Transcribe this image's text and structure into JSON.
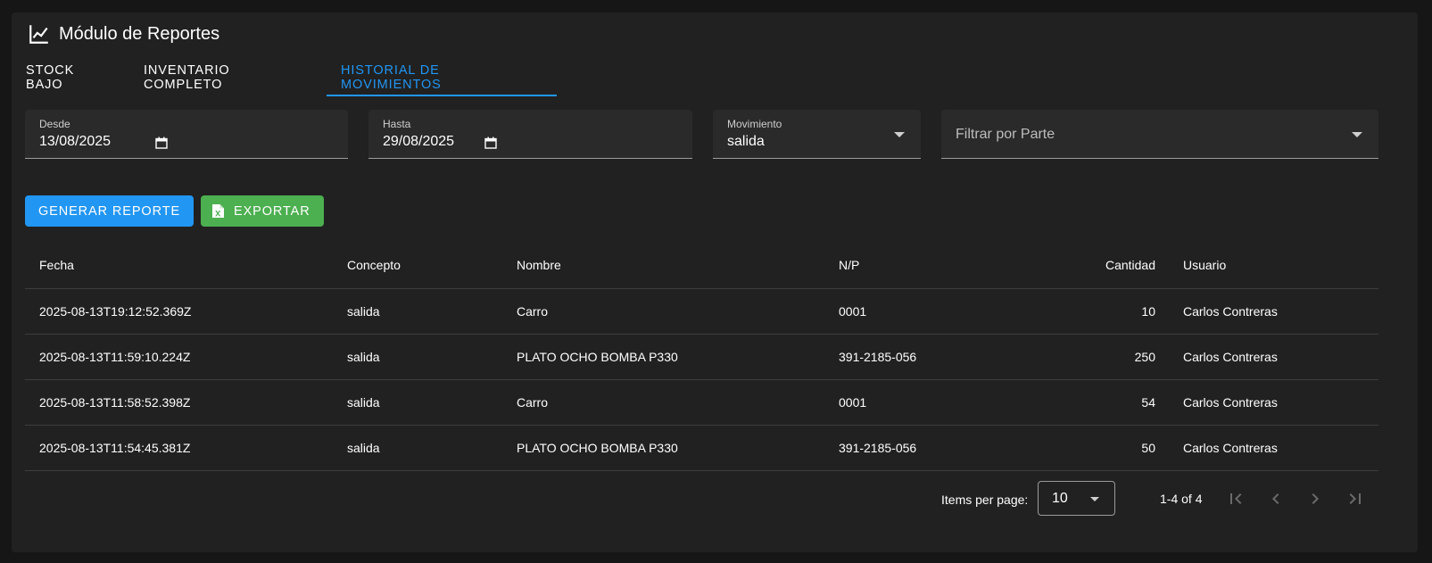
{
  "header": {
    "title": "Módulo de Reportes",
    "icon": "line-chart-icon"
  },
  "tabs": [
    {
      "label": "STOCK BAJO"
    },
    {
      "label": "INVENTARIO COMPLETO"
    },
    {
      "label": "HISTORIAL DE MOVIMIENTOS"
    }
  ],
  "active_tab": "HISTORIAL DE MOVIMIENTOS",
  "filters": {
    "desde": {
      "label": "Desde",
      "value": "13/08/2025"
    },
    "hasta": {
      "label": "Hasta",
      "value": "29/08/2025"
    },
    "movimiento": {
      "label": "Movimiento",
      "value": "salida"
    },
    "parte": {
      "placeholder": "Filtrar por Parte"
    }
  },
  "actions": {
    "generate_label": "GENERAR REPORTE",
    "export_label": "EXPORTAR"
  },
  "table": {
    "columns": [
      "Fecha",
      "Concepto",
      "Nombre",
      "N/P",
      "Cantidad",
      "Usuario"
    ],
    "rows": [
      {
        "fecha": "2025-08-13T19:12:52.369Z",
        "concepto": "salida",
        "nombre": "Carro",
        "np": "0001",
        "cantidad": "10",
        "usuario": "Carlos Contreras"
      },
      {
        "fecha": "2025-08-13T11:59:10.224Z",
        "concepto": "salida",
        "nombre": "PLATO OCHO BOMBA P330",
        "np": "391-2185-056",
        "cantidad": "250",
        "usuario": "Carlos Contreras"
      },
      {
        "fecha": "2025-08-13T11:58:52.398Z",
        "concepto": "salida",
        "nombre": "Carro",
        "np": "0001",
        "cantidad": "54",
        "usuario": "Carlos Contreras"
      },
      {
        "fecha": "2025-08-13T11:54:45.381Z",
        "concepto": "salida",
        "nombre": "PLATO OCHO BOMBA P330",
        "np": "391-2185-056",
        "cantidad": "50",
        "usuario": "Carlos Contreras"
      }
    ]
  },
  "paginator": {
    "items_per_page_label": "Items per page:",
    "page_size": "10",
    "range_label": "1-4 of 4"
  },
  "colors": {
    "background": "#161616",
    "card": "#212121",
    "accent": "#2196f3",
    "export": "#4caf50"
  }
}
